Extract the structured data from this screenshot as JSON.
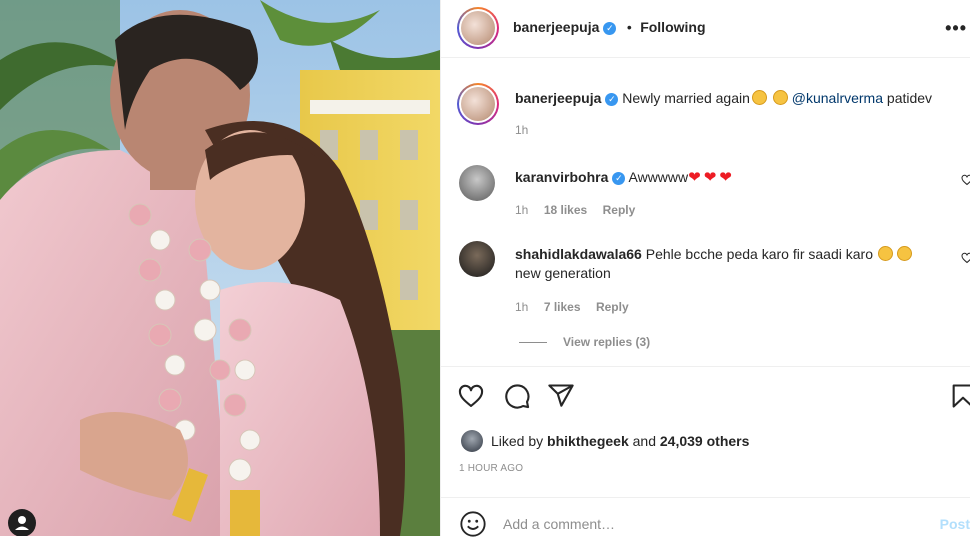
{
  "post": {
    "author": "banerjeepuja",
    "follow_status": "Following",
    "more_menu": "•••",
    "caption": {
      "user": "banerjeepuja",
      "text": "Newly married again",
      "mention": "@kunalrverma",
      "tail": "patidev",
      "time": "1h"
    },
    "comments": [
      {
        "user": "karanvirbohra",
        "verified": true,
        "text": "Awwwww",
        "time": "1h",
        "likes": "18 likes",
        "reply": "Reply"
      },
      {
        "user": "shahidlakdawala66",
        "verified": false,
        "text_line1": "Pehle bcche peda karo fir saadi karo",
        "text_line2": "new generation",
        "time": "1h",
        "likes": "7 likes",
        "reply": "Reply",
        "view_replies": "View replies (3)"
      }
    ],
    "liked_by": {
      "prefix": "Liked by",
      "user": "bhikthegeek",
      "middle": "and",
      "count": "24,039 others"
    },
    "timestamp": "1 HOUR AGO",
    "comment_placeholder": "Add a comment…",
    "post_label": "Post"
  },
  "icons": {
    "like": "heart-outline-icon",
    "comment": "speech-bubble-icon",
    "share": "paper-plane-icon",
    "save": "bookmark-icon",
    "emoji": "smiley-icon",
    "user_tag": "user-tag-icon",
    "verified": "verified-badge-icon"
  },
  "colors": {
    "verified": "#3897f0",
    "muted": "#8e8e8e",
    "link": "#00376b",
    "post_disabled": "#b2dffc",
    "heart": "#ed1c24"
  }
}
